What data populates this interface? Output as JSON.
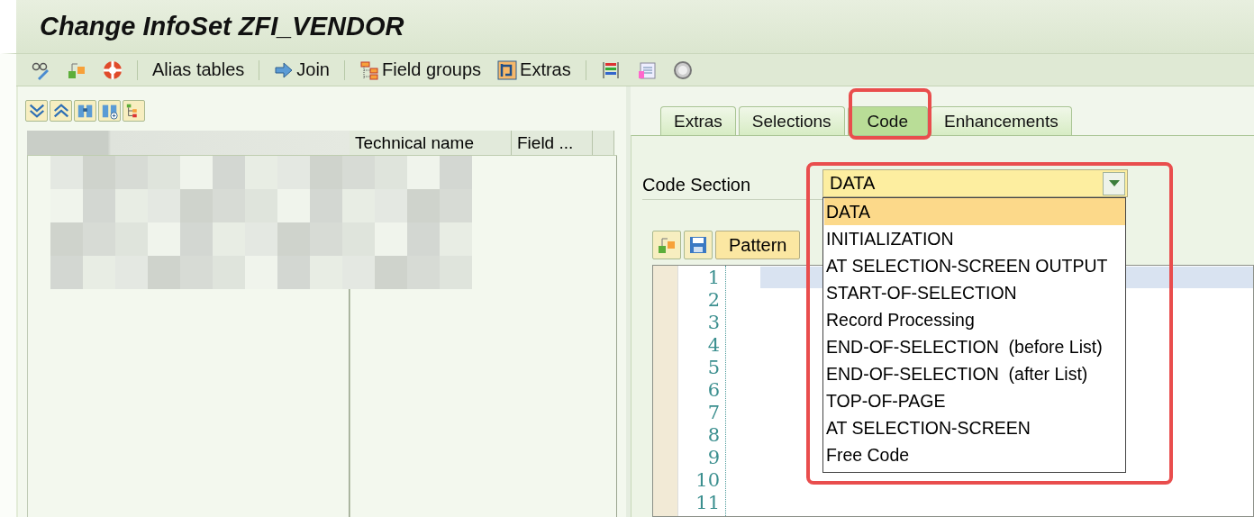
{
  "window": {
    "title": "Change InfoSet ZFI_VENDOR"
  },
  "toolbar": {
    "buttons": [
      {
        "kind": "alias",
        "label": "Alias tables"
      },
      {
        "kind": "join",
        "label": "Join"
      },
      {
        "kind": "groups",
        "label": "Field groups"
      },
      {
        "kind": "extras",
        "label": "Extras"
      }
    ]
  },
  "field_list": {
    "columns": [
      {
        "label": "Technical name"
      },
      {
        "label": "Field ..."
      }
    ]
  },
  "tabs": [
    {
      "label": "Extras",
      "selected": false
    },
    {
      "label": "Selections",
      "selected": false
    },
    {
      "label": "Code",
      "selected": true
    },
    {
      "label": "Enhancements",
      "selected": false
    }
  ],
  "code_section": {
    "label": "Code Section",
    "value": "DATA",
    "expanded": true,
    "options": [
      {
        "label": "DATA",
        "selected": true
      },
      {
        "label": "INITIALIZATION",
        "selected": false
      },
      {
        "label": "AT SELECTION-SCREEN OUTPUT",
        "selected": false
      },
      {
        "label": "START-OF-SELECTION",
        "selected": false
      },
      {
        "label": "Record Processing",
        "selected": false
      },
      {
        "label": "END-OF-SELECTION  (before List)",
        "selected": false
      },
      {
        "label": "END-OF-SELECTION  (after List)",
        "selected": false
      },
      {
        "label": "TOP-OF-PAGE",
        "selected": false
      },
      {
        "label": "AT SELECTION-SCREEN",
        "selected": false
      },
      {
        "label": "Free Code",
        "selected": false
      }
    ]
  },
  "editor": {
    "toolbar": {
      "pattern_button": "Pattern"
    },
    "line_numbers": [
      "1",
      "2",
      "3",
      "4",
      "5",
      "6",
      "7",
      "8",
      "9",
      "10",
      "11"
    ]
  }
}
